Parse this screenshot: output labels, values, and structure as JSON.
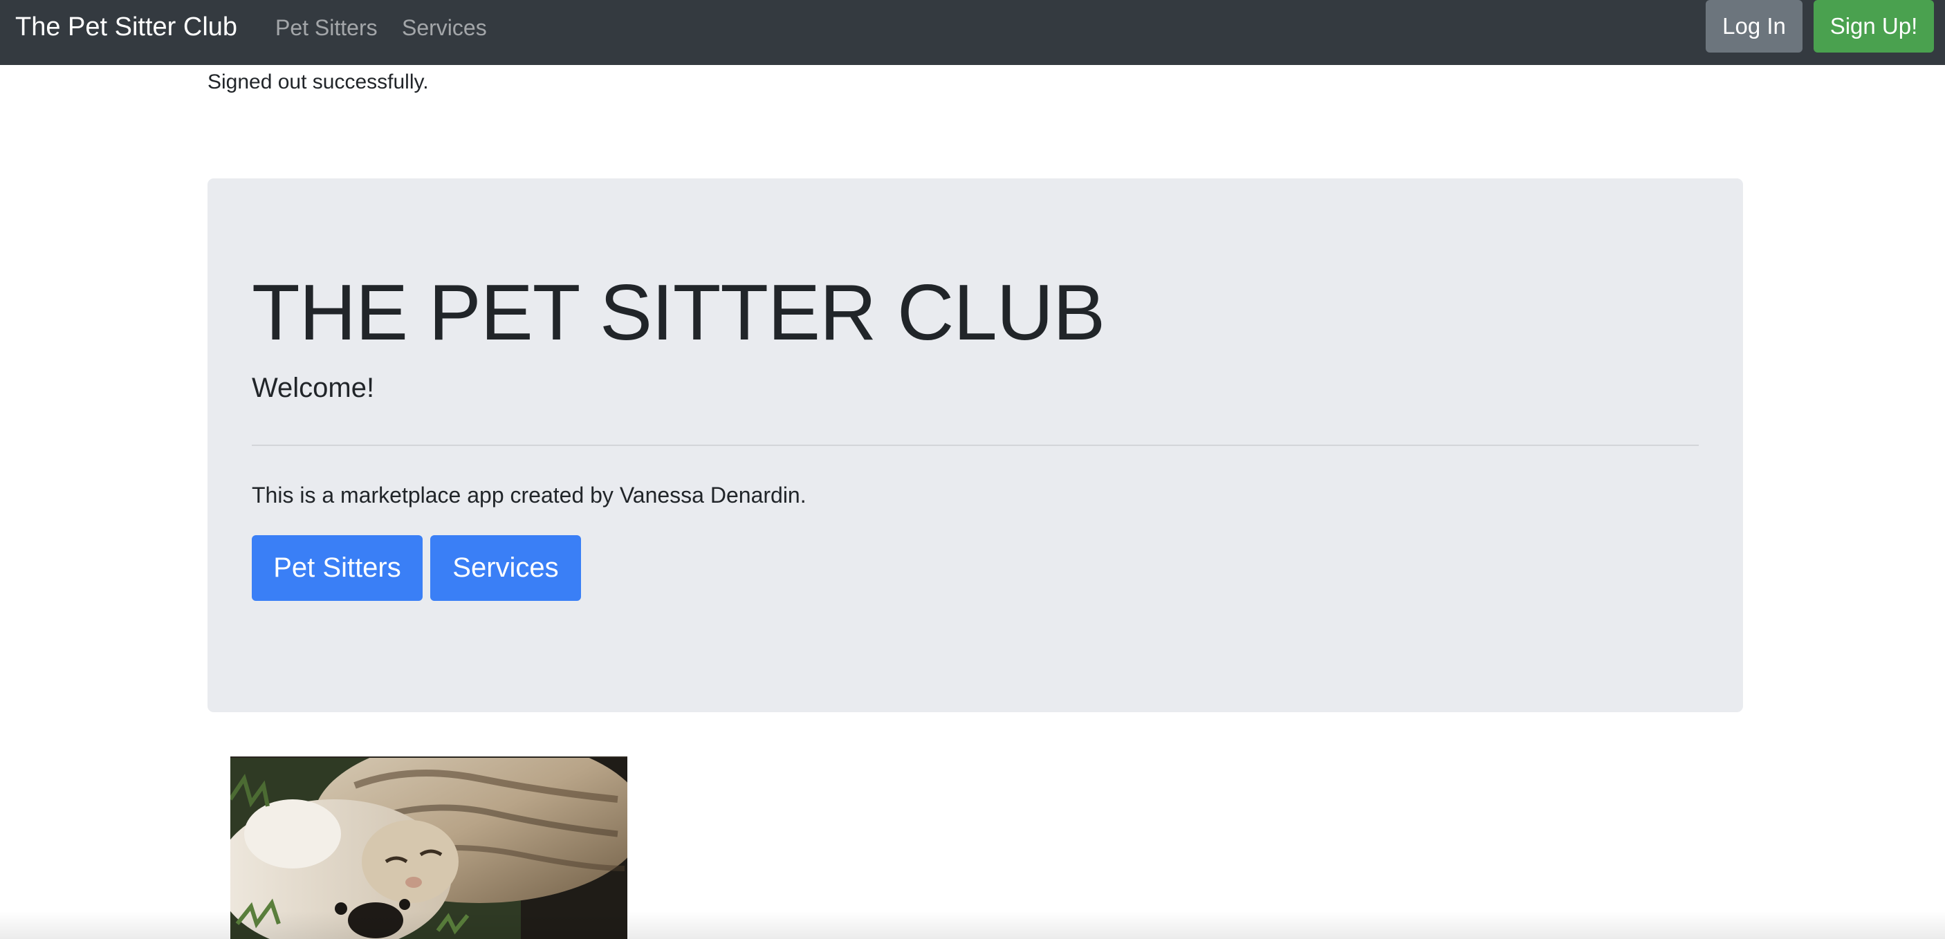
{
  "navbar": {
    "brand": "The Pet Sitter Club",
    "links": [
      "Pet Sitters",
      "Services"
    ],
    "login_label": "Log In",
    "signup_label": "Sign Up!"
  },
  "flash": {
    "message": "Signed out successfully."
  },
  "jumbotron": {
    "title": "THE PET SITTER CLUB",
    "lead": "Welcome!",
    "description": "This is a marketplace app created by Vanessa Denardin.",
    "buttons": [
      "Pet Sitters",
      "Services"
    ]
  },
  "colors": {
    "navbar_bg": "#343a40",
    "login_bg": "#6c757d",
    "signup_bg": "#4aa14f",
    "primary": "#3a7ff6",
    "jumbotron_bg": "#e9ebef"
  },
  "icons": {
    "photo": "cat-and-dog-photo"
  }
}
